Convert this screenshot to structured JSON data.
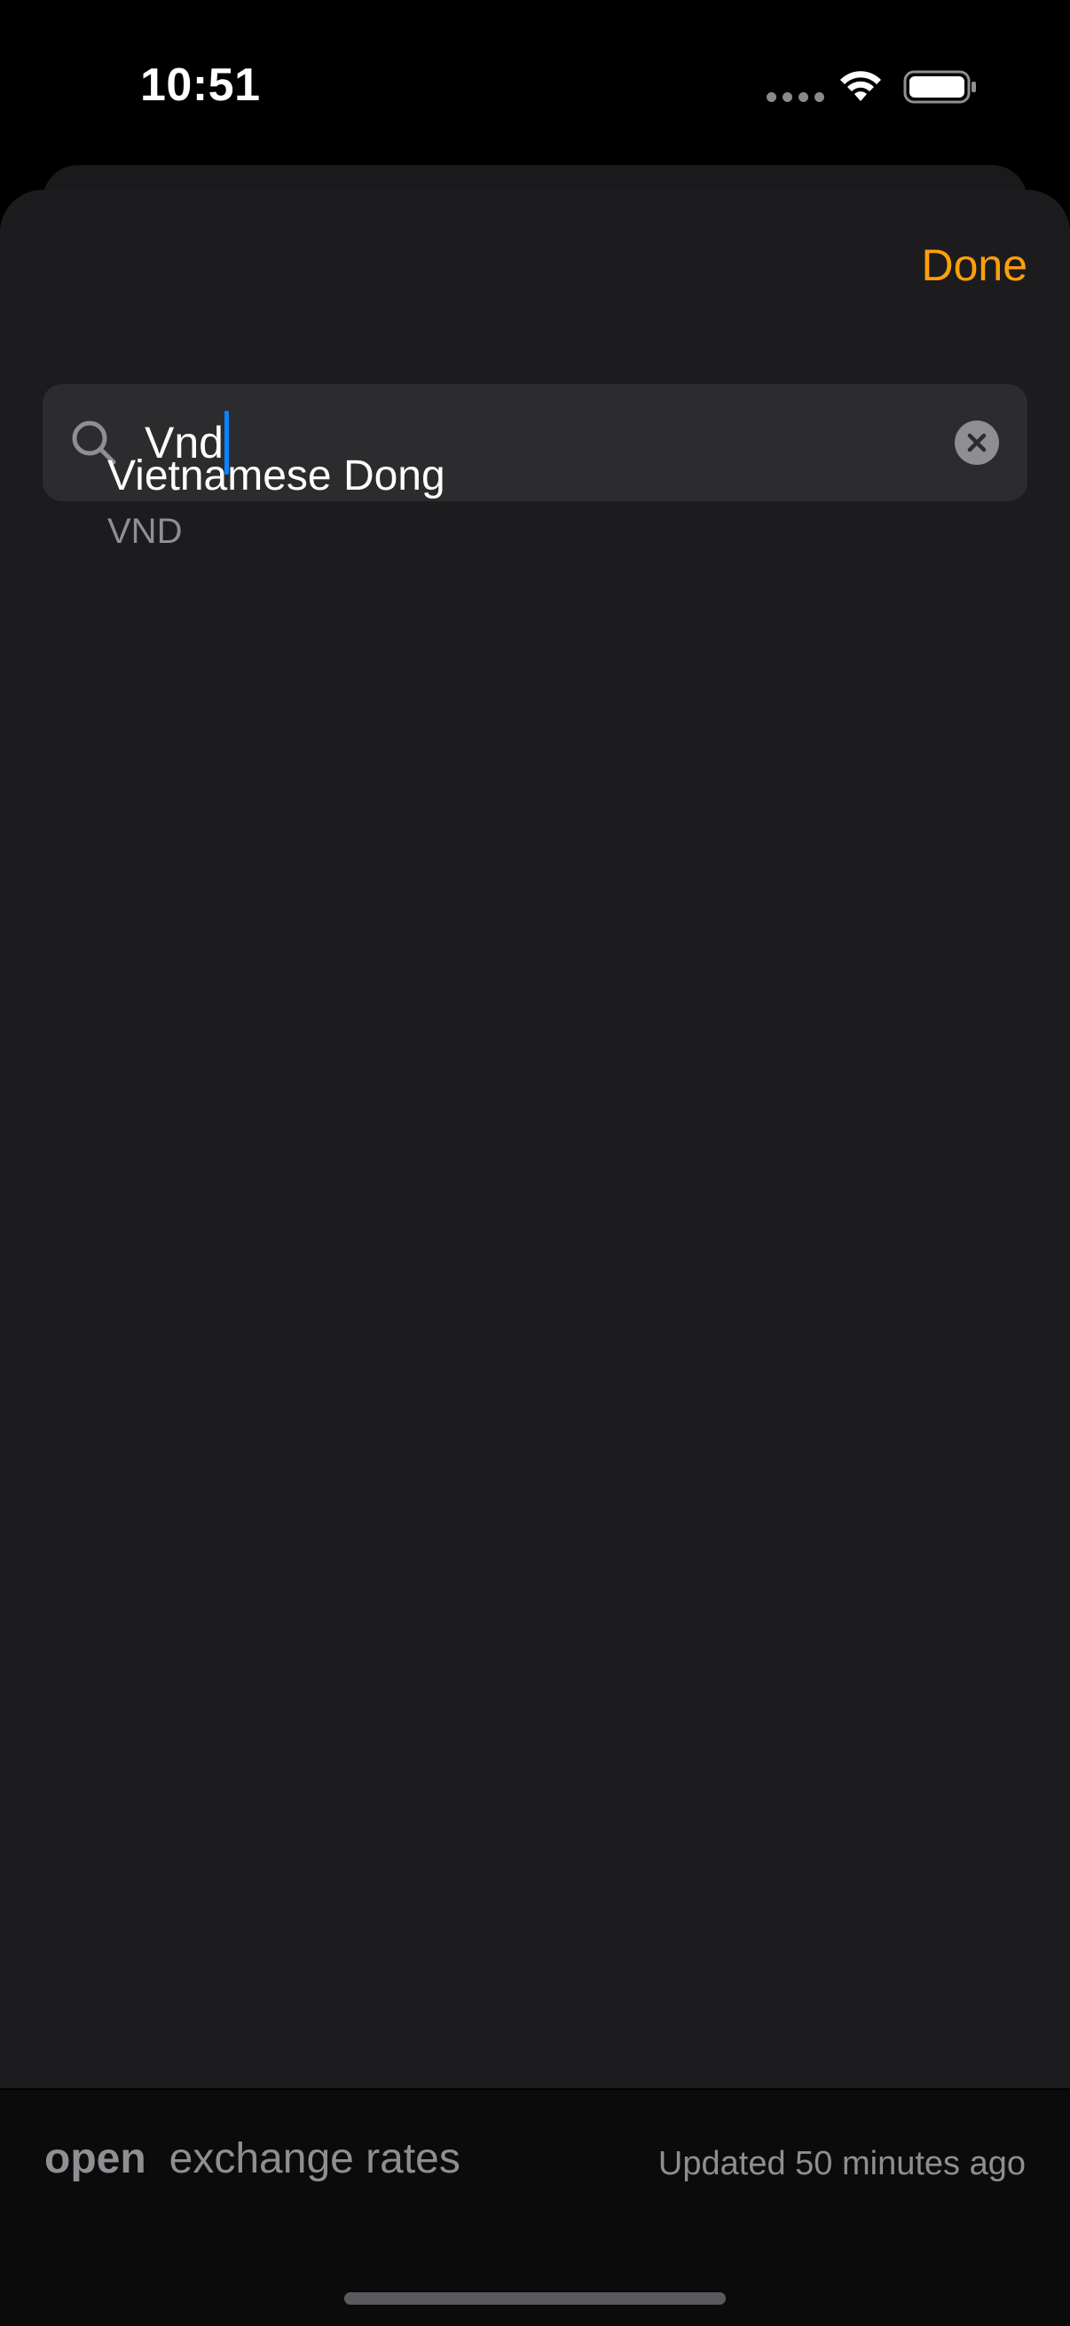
{
  "status_bar": {
    "time": "10:51"
  },
  "sheet": {
    "done_label": "Done",
    "search": {
      "value": "Vnd",
      "icon": "search-icon",
      "clear_icon": "clear-icon"
    },
    "results": [
      {
        "name": "Vietnamese Dong",
        "code": "VND"
      }
    ]
  },
  "footer": {
    "brand_bold": "open",
    "brand_rest": "exchange rates",
    "updated": "Updated 50 minutes ago"
  },
  "colors": {
    "accent": "#ff9f0a",
    "caret": "#0a84ff",
    "background": "#1c1c1e"
  }
}
